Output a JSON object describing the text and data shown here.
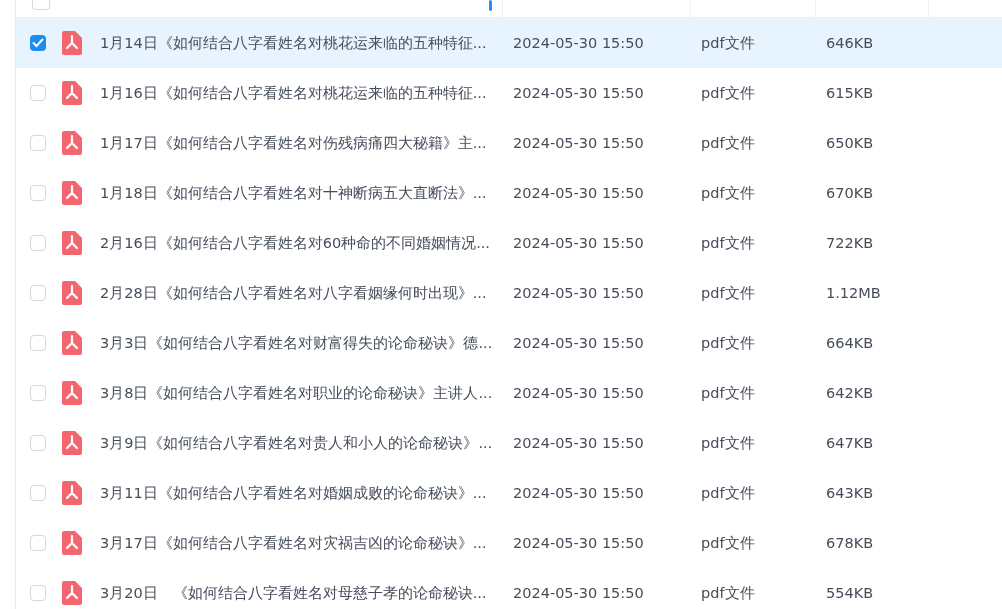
{
  "header": {
    "select_all_checked": false
  },
  "files": [
    {
      "name": "1月14日《如何结合八字看姓名对桃花运来临的五种特征...",
      "modified": "2024-05-30 15:50",
      "type": "pdf文件",
      "size": "646KB",
      "selected": true
    },
    {
      "name": "1月16日《如何结合八字看姓名对桃花运来临的五种特征...",
      "modified": "2024-05-30 15:50",
      "type": "pdf文件",
      "size": "615KB",
      "selected": false
    },
    {
      "name": "1月17日《如何结合八字看姓名对伤残病痛四大秘籍》主...",
      "modified": "2024-05-30 15:50",
      "type": "pdf文件",
      "size": "650KB",
      "selected": false
    },
    {
      "name": "1月18日《如何结合八字看姓名对十神断病五大直断法》...",
      "modified": "2024-05-30 15:50",
      "type": "pdf文件",
      "size": "670KB",
      "selected": false
    },
    {
      "name": "2月16日《如何结合八字看姓名对60种命的不同婚姻情况...",
      "modified": "2024-05-30 15:50",
      "type": "pdf文件",
      "size": "722KB",
      "selected": false
    },
    {
      "name": "2月28日《如何结合八字看姓名对八字看姻缘何时出现》...",
      "modified": "2024-05-30 15:50",
      "type": "pdf文件",
      "size": "1.12MB",
      "selected": false
    },
    {
      "name": "3月3日《如何结合八字看姓名对财富得失的论命秘诀》德...",
      "modified": "2024-05-30 15:50",
      "type": "pdf文件",
      "size": "664KB",
      "selected": false
    },
    {
      "name": "3月8日《如何结合八字看姓名对职业的论命秘诀》主讲人...",
      "modified": "2024-05-30 15:50",
      "type": "pdf文件",
      "size": "642KB",
      "selected": false
    },
    {
      "name": "3月9日《如何结合八字看姓名对贵人和小人的论命秘诀》...",
      "modified": "2024-05-30 15:50",
      "type": "pdf文件",
      "size": "647KB",
      "selected": false
    },
    {
      "name": "3月11日《如何结合八字看姓名对婚姻成败的论命秘诀》...",
      "modified": "2024-05-30 15:50",
      "type": "pdf文件",
      "size": "643KB",
      "selected": false
    },
    {
      "name": "3月17日《如何结合八字看姓名对灾祸吉凶的论命秘诀》...",
      "modified": "2024-05-30 15:50",
      "type": "pdf文件",
      "size": "678KB",
      "selected": false
    },
    {
      "name": "3月20日　《如何结合八字看姓名对母慈子孝的论命秘诀...",
      "modified": "2024-05-30 15:50",
      "type": "pdf文件",
      "size": "554KB",
      "selected": false
    }
  ]
}
